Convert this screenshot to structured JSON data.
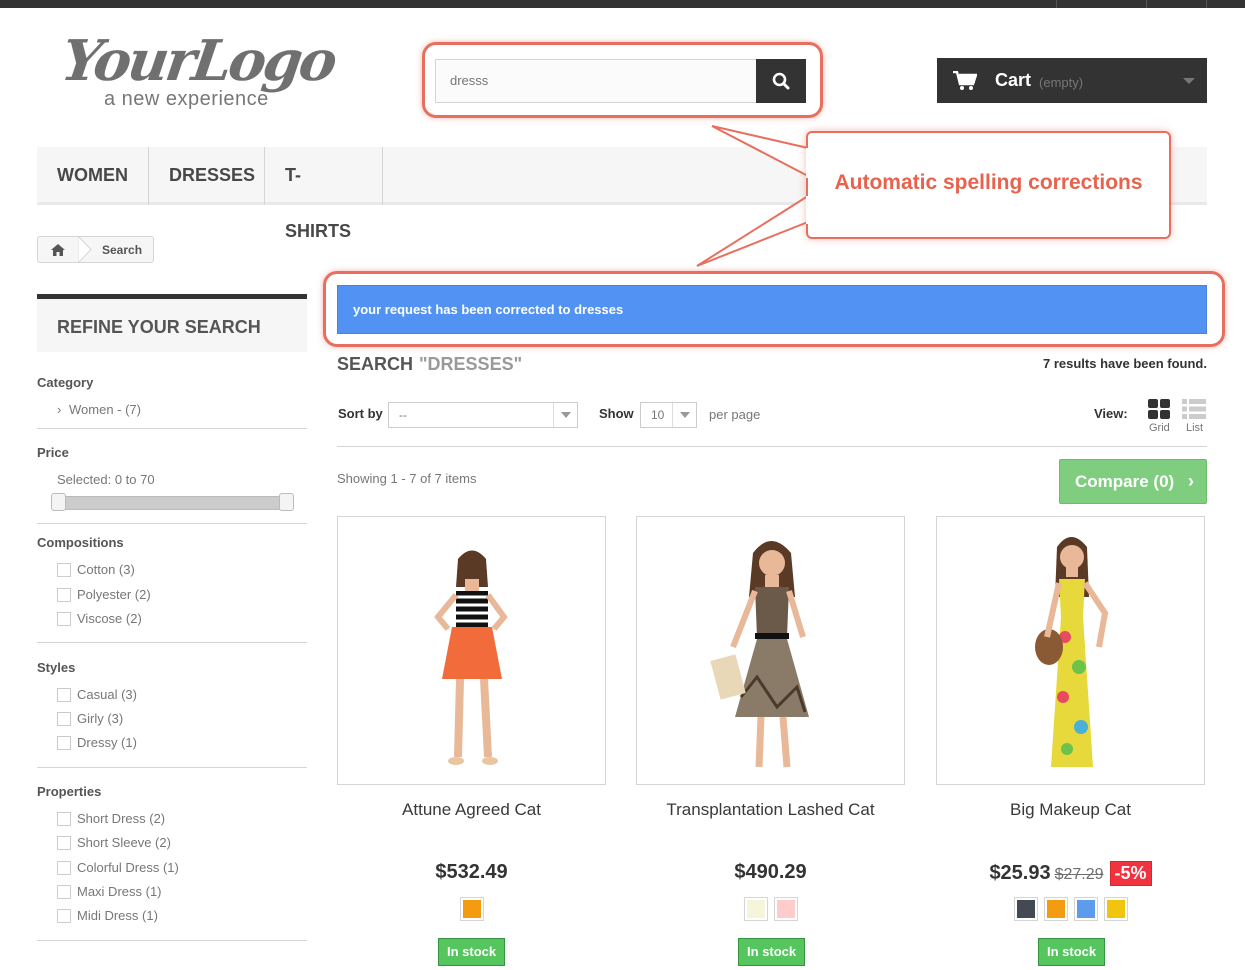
{
  "logo": {
    "main": "YourLogo",
    "tagline": "a new experience"
  },
  "search": {
    "value": "dresss",
    "button_icon": "search-icon"
  },
  "cart": {
    "label": "Cart",
    "status": "(empty)",
    "icon": "cart-icon"
  },
  "menu": {
    "items": [
      {
        "label": "WOMEN"
      },
      {
        "label": "DRESSES"
      },
      {
        "label": "T-SHIRTS"
      }
    ]
  },
  "callout": {
    "text": "Automatic spelling corrections",
    "color": "#e86f5d"
  },
  "breadcrumb": {
    "home_icon": "home-icon",
    "current": "Search"
  },
  "notice": {
    "text": "your request has been corrected to dresses",
    "color": "#5192f3"
  },
  "sidebar": {
    "title": "REFINE YOUR SEARCH",
    "category": {
      "title": "Category",
      "items": [
        {
          "label": "Women - (7)"
        }
      ]
    },
    "price": {
      "title": "Price",
      "selected": "Selected: 0 to 70",
      "range": [
        0,
        70
      ]
    },
    "compositions": {
      "title": "Compositions",
      "items": [
        {
          "label": "Cotton (3)"
        },
        {
          "label": "Polyester (2)"
        },
        {
          "label": "Viscose (2)"
        }
      ]
    },
    "styles": {
      "title": "Styles",
      "items": [
        {
          "label": "Casual (3)"
        },
        {
          "label": "Girly (3)"
        },
        {
          "label": "Dressy (1)"
        }
      ]
    },
    "properties": {
      "title": "Properties",
      "items": [
        {
          "label": "Short Dress (2)"
        },
        {
          "label": "Short Sleeve (2)"
        },
        {
          "label": "Colorful Dress (1)"
        },
        {
          "label": "Maxi Dress (1)"
        },
        {
          "label": "Midi Dress (1)"
        }
      ]
    }
  },
  "results": {
    "heading": "SEARCH",
    "query": "\"DRESSES\"",
    "count_text": "7 results have been found.",
    "sort_label": "Sort by",
    "sort_value": "--",
    "show_label": "Show",
    "show_value": "10",
    "per_page": "per page",
    "view_label": "View:",
    "view_grid": "Grid",
    "view_list": "List",
    "showing": "Showing 1 - 7 of 7 items",
    "compare": "Compare (0)"
  },
  "products": [
    {
      "name": "Attune Agreed Cat",
      "price": "$532.49",
      "old_price": "",
      "discount": "",
      "colors": [
        "#f39c11"
      ],
      "stock": "In stock",
      "dress_color": "#f26b3a"
    },
    {
      "name": "Transplantation Lashed Cat",
      "price": "$490.29",
      "old_price": "",
      "discount": "",
      "colors": [
        "#f5f5dc",
        "#fcc"
      ],
      "stock": "In stock",
      "dress_color": "#6b5a4a"
    },
    {
      "name": "Big Makeup Cat",
      "price": "$25.93",
      "old_price": "$27.29",
      "discount": "-5%",
      "colors": [
        "#434a54",
        "#f39c11",
        "#5d9cec",
        "#f1c40f"
      ],
      "stock": "In stock",
      "dress_color": "#e7d83c"
    }
  ]
}
